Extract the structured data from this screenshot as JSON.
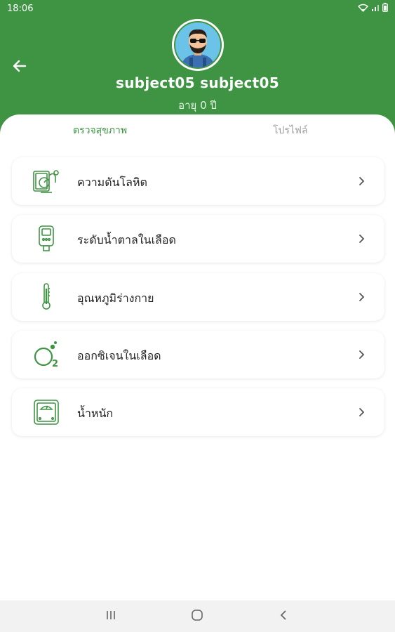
{
  "status": {
    "time": "18:06"
  },
  "profile": {
    "name": "subject05 subject05",
    "age": "อายุ 0 ปี"
  },
  "tabs": [
    {
      "label": "ตรวจสุขภาพ",
      "active": true
    },
    {
      "label": "โปรไฟล์",
      "active": false
    }
  ],
  "menu": [
    {
      "label": "ความดันโลหิต",
      "icon": "blood-pressure-icon"
    },
    {
      "label": "ระดับน้ำตาลในเลือด",
      "icon": "glucose-meter-icon"
    },
    {
      "label": "อุณหภูมิร่างกาย",
      "icon": "thermometer-icon"
    },
    {
      "label": "ออกซิเจนในเลือด",
      "icon": "oxygen-icon"
    },
    {
      "label": "น้ำหนัก",
      "icon": "weight-scale-icon"
    }
  ],
  "colors": {
    "primary": "#3f9443",
    "inactive_tab": "#9e9e9e"
  }
}
